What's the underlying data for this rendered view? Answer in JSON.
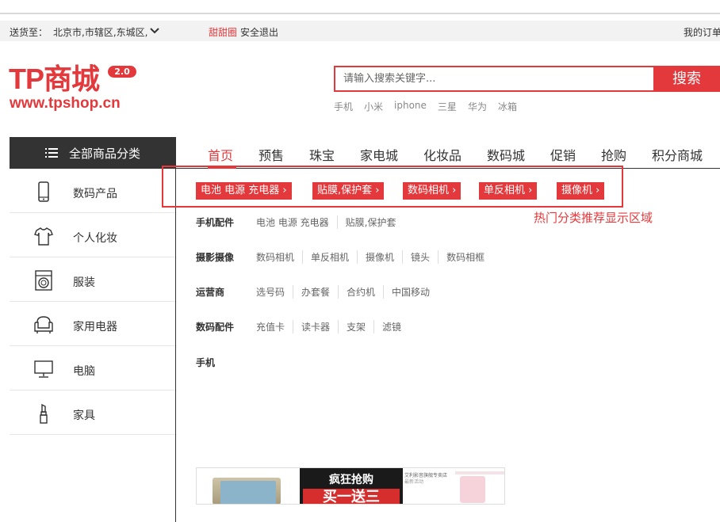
{
  "topbar": {
    "ship_to_label": "送货至：",
    "address": "北京市,市辖区,东城区,",
    "username": "甜甜圈",
    "logout": "安全退出",
    "my_orders": "我的订单"
  },
  "logo": {
    "name": "TP商城",
    "version": "2.0",
    "url": "www.tpshop.cn"
  },
  "search": {
    "placeholder": "请输入搜索关键字...",
    "button": "搜索",
    "hot_words": [
      "手机",
      "小米",
      "iphone",
      "三星",
      "华为",
      "冰箱"
    ]
  },
  "category_header": "全部商品分类",
  "nav": {
    "items": [
      "首页",
      "预售",
      "珠宝",
      "家电城",
      "化妆品",
      "数码城",
      "促销",
      "抢购",
      "积分商城"
    ],
    "active_index": 0
  },
  "sidebar": {
    "items": [
      {
        "label": "数码产品",
        "icon": "phone-icon"
      },
      {
        "label": "个人化妆",
        "icon": "tshirt-icon"
      },
      {
        "label": "服装",
        "icon": "washer-icon"
      },
      {
        "label": "家用电器",
        "icon": "armchair-icon"
      },
      {
        "label": "电脑",
        "icon": "monitor-icon"
      },
      {
        "label": "家具",
        "icon": "lipstick-icon"
      }
    ]
  },
  "hot_tags": [
    "电池 电源 充电器",
    "贴膜,保护套",
    "数码相机",
    "单反相机",
    "摄像机"
  ],
  "hot_tag_arrow": "›",
  "hot_area_note": "热门分类推荐显示区域",
  "sub_categories": [
    {
      "title": "手机配件",
      "links": [
        "电池 电源 充电器",
        "贴膜,保护套"
      ]
    },
    {
      "title": "摄影摄像",
      "links": [
        "数码相机",
        "单反相机",
        "摄像机",
        "镜头",
        "数码相框"
      ]
    },
    {
      "title": "运营商",
      "links": [
        "选号码",
        "办套餐",
        "合约机",
        "中国移动"
      ]
    },
    {
      "title": "数码配件",
      "links": [
        "充值卡",
        "读卡器",
        "支架",
        "滤镜"
      ]
    },
    {
      "title": "手机",
      "links": []
    }
  ],
  "ad": {
    "promo_top": "疯狂抢购",
    "promo_bottom": "买一送三",
    "shop_name": "艾利影音旗舰专卖店",
    "shop_sub": "最新活动"
  },
  "colors": {
    "accent": "#e4393c",
    "dark": "#333333"
  }
}
